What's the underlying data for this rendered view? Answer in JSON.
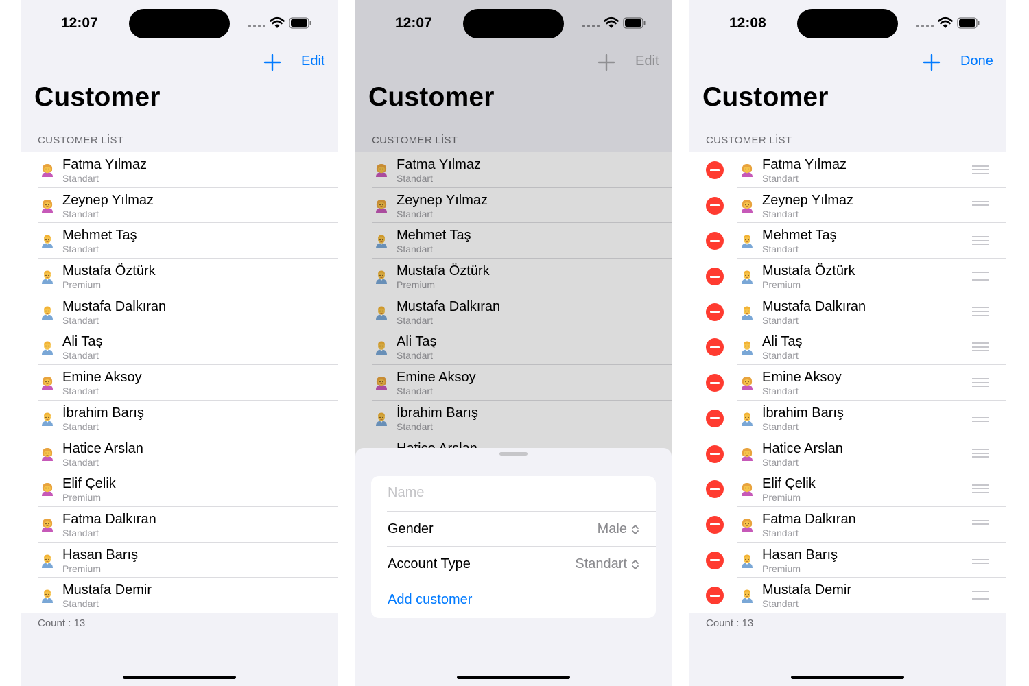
{
  "customers": [
    {
      "name": "Fatma Yılmaz",
      "account": "Standart",
      "gender": "female"
    },
    {
      "name": "Zeynep Yılmaz",
      "account": "Standart",
      "gender": "female"
    },
    {
      "name": "Mehmet Taş",
      "account": "Standart",
      "gender": "male"
    },
    {
      "name": "Mustafa Öztürk",
      "account": "Premium",
      "gender": "male"
    },
    {
      "name": "Mustafa Dalkıran",
      "account": "Standart",
      "gender": "male"
    },
    {
      "name": "Ali Taş",
      "account": "Standart",
      "gender": "male"
    },
    {
      "name": "Emine Aksoy",
      "account": "Standart",
      "gender": "female"
    },
    {
      "name": "İbrahim Barış",
      "account": "Standart",
      "gender": "male"
    },
    {
      "name": "Hatice Arslan",
      "account": "Standart",
      "gender": "female"
    },
    {
      "name": "Elif Çelik",
      "account": "Premium",
      "gender": "female"
    },
    {
      "name": "Fatma Dalkıran",
      "account": "Standart",
      "gender": "female"
    },
    {
      "name": "Hasan Barış",
      "account": "Premium",
      "gender": "male"
    },
    {
      "name": "Mustafa Demir",
      "account": "Standart",
      "gender": "male"
    }
  ],
  "icons": {
    "female": "person-woman-emoji-icon",
    "male": "person-man-emoji-icon",
    "add": "plus-icon",
    "delete": "minus-circle-icon",
    "reorder": "reorder-handle-icon",
    "wifi": "wifi-icon",
    "battery": "battery-icon",
    "select": "chevron-up-down-icon"
  },
  "colors": {
    "accent": "#007aff",
    "delete": "#ff3b30",
    "background": "#f2f2f7"
  },
  "screens": [
    {
      "time": "12:07",
      "nav_right": "Edit",
      "title": "Customer",
      "section_header": "CUSTOMER LİST",
      "footer": "Count : 13"
    },
    {
      "time": "12:07",
      "nav_right": "Edit",
      "title": "Customer",
      "section_header": "CUSTOMER LİST",
      "sheet": {
        "name_placeholder": "Name",
        "gender_label": "Gender",
        "gender_value": "Male",
        "account_label": "Account Type",
        "account_value": "Standart",
        "add_button": "Add customer"
      }
    },
    {
      "time": "12:08",
      "nav_right": "Done",
      "title": "Customer",
      "section_header": "CUSTOMER LİST",
      "footer": "Count : 13"
    }
  ]
}
